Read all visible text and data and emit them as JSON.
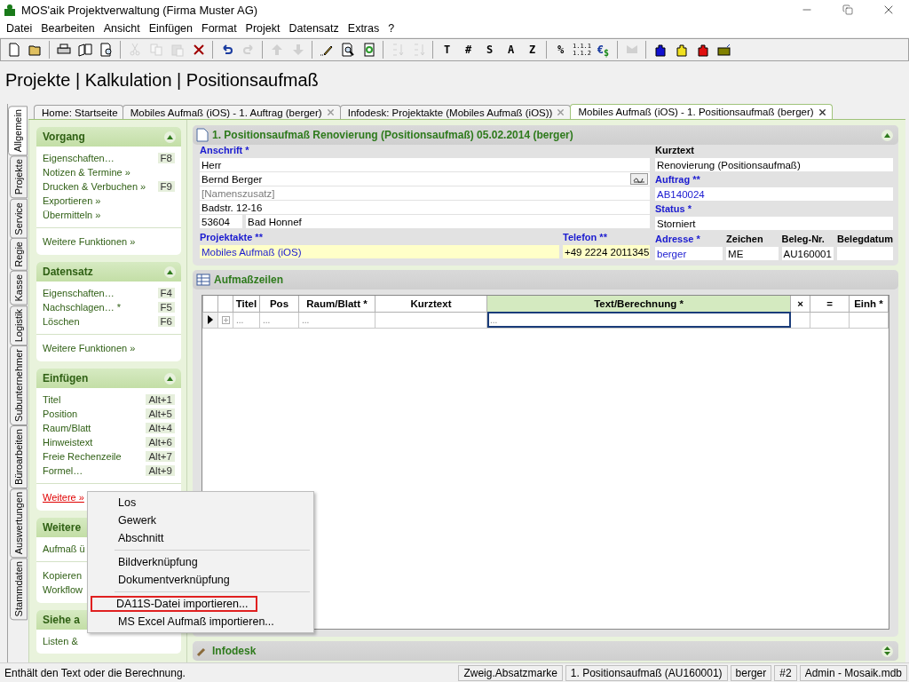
{
  "window": {
    "title": "MOS'aik Projektverwaltung (Firma Muster AG)"
  },
  "menu_bar": [
    "Datei",
    "Bearbeiten",
    "Ansicht",
    "Einfügen",
    "Format",
    "Projekt",
    "Datensatz",
    "Extras",
    "?"
  ],
  "toolbar": [
    {
      "kind": "icon",
      "disabled": false
    },
    {
      "kind": "icon",
      "disabled": false
    },
    {
      "kind": "separator"
    },
    {
      "kind": "icon",
      "disabled": false
    },
    {
      "kind": "icon",
      "disabled": false
    },
    {
      "kind": "icon",
      "disabled": false
    },
    {
      "kind": "separator"
    },
    {
      "kind": "icon",
      "disabled": true
    },
    {
      "kind": "icon",
      "disabled": true
    },
    {
      "kind": "icon",
      "disabled": true
    },
    {
      "kind": "icon",
      "disabled": false
    },
    {
      "kind": "separator"
    },
    {
      "kind": "icon",
      "disabled": false
    },
    {
      "kind": "icon",
      "disabled": true
    },
    {
      "kind": "separator"
    },
    {
      "kind": "icon",
      "disabled": true
    },
    {
      "kind": "icon",
      "disabled": true
    },
    {
      "kind": "separator"
    },
    {
      "kind": "icon",
      "disabled": false
    },
    {
      "kind": "icon",
      "disabled": false
    },
    {
      "kind": "icon",
      "disabled": false
    },
    {
      "kind": "separator"
    },
    {
      "kind": "icon",
      "disabled": true
    },
    {
      "kind": "icon",
      "disabled": true
    },
    {
      "kind": "separator"
    },
    {
      "kind": "text",
      "label": "T"
    },
    {
      "kind": "text",
      "label": "#"
    },
    {
      "kind": "text",
      "label": "S"
    },
    {
      "kind": "text",
      "label": "A"
    },
    {
      "kind": "text",
      "label": "Z"
    },
    {
      "kind": "separator"
    },
    {
      "kind": "text",
      "label": "%"
    },
    {
      "kind": "numbering",
      "lines": [
        "1.1.1",
        "1.1.2"
      ]
    },
    {
      "kind": "currency",
      "symbols": [
        "€",
        "$"
      ]
    },
    {
      "kind": "separator"
    },
    {
      "kind": "icon",
      "disabled": true
    },
    {
      "kind": "separator"
    },
    {
      "kind": "icon",
      "disabled": false
    },
    {
      "kind": "icon",
      "disabled": false
    },
    {
      "kind": "icon",
      "disabled": false
    },
    {
      "kind": "icon",
      "disabled": false
    }
  ],
  "heading": "Projekte | Kalkulation | Positionsaufmaß",
  "side_tabs": [
    {
      "label": "Allgemein",
      "selected": true
    },
    {
      "label": "Projekte",
      "selected": false
    },
    {
      "label": "Service",
      "selected": false
    },
    {
      "label": "Regie",
      "selected": false
    },
    {
      "label": "Kasse",
      "selected": false
    },
    {
      "label": "Logistik",
      "selected": false
    },
    {
      "label": "Subunternehmer",
      "selected": false
    },
    {
      "label": "Büroarbeiten",
      "selected": false
    },
    {
      "label": "Auswertungen",
      "selected": false
    },
    {
      "label": "Stammdaten",
      "selected": false
    }
  ],
  "doc_tabs": [
    {
      "label": "Home: Startseite",
      "selected": false,
      "closable": false
    },
    {
      "label": "Mobiles Aufmaß (iOS) - 1. Auftrag (berger)",
      "selected": false,
      "closable": true
    },
    {
      "label": "Infodesk: Projektakte (Mobiles Aufmaß (iOS))",
      "selected": false,
      "closable": true
    },
    {
      "label": "Mobiles Aufmaß (iOS) - 1. Positionsaufmaß (berger)",
      "selected": true,
      "closable": true
    }
  ],
  "sidebar": [
    {
      "title": "Vorgang",
      "collapsible": true,
      "items": [
        {
          "label": "Eigenschaften…",
          "shortcut": "F8"
        },
        {
          "label": "Notizen & Termine »"
        },
        {
          "label": "Drucken & Verbuchen »",
          "shortcut": "F9"
        },
        {
          "label": "Exportieren »"
        },
        {
          "label": "Übermitteln »"
        }
      ],
      "footer": [
        {
          "label": "Weitere Funktionen »",
          "hovered": false
        }
      ]
    },
    {
      "title": "Datensatz",
      "collapsible": true,
      "items": [
        {
          "label": "Eigenschaften…",
          "shortcut": "F4"
        },
        {
          "label": "Nachschlagen… *",
          "shortcut": "F5"
        },
        {
          "label": "Löschen",
          "shortcut": "F6"
        }
      ],
      "footer": [
        {
          "label": "Weitere Funktionen »",
          "hovered": false
        }
      ]
    },
    {
      "title": "Einfügen",
      "collapsible": true,
      "items": [
        {
          "label": "Titel",
          "shortcut": "Alt+1"
        },
        {
          "label": "Position",
          "shortcut": "Alt+5"
        },
        {
          "label": "Raum/Blatt",
          "shortcut": "Alt+4"
        },
        {
          "label": "Hinweistext",
          "shortcut": "Alt+6"
        },
        {
          "label": "Freie Rechenzeile",
          "shortcut": "Alt+7"
        },
        {
          "label": "Formel…",
          "shortcut": "Alt+9"
        }
      ],
      "footer": [
        {
          "label": "Weitere »",
          "hovered": true
        }
      ]
    },
    {
      "title": "Weitere",
      "items": [
        {
          "label": "Aufmaß ü"
        }
      ],
      "footer": [
        {
          "label": "Kopieren",
          "hovered": false
        },
        {
          "label": "Workflow",
          "hovered": false
        }
      ]
    },
    {
      "title": "Siehe a",
      "items": [
        {
          "label": "Listen &"
        }
      ]
    }
  ],
  "context_menu": [
    {
      "kind": "item",
      "label": "Los",
      "selected": false
    },
    {
      "kind": "item",
      "label": "Gewerk",
      "selected": false
    },
    {
      "kind": "item",
      "label": "Abschnitt",
      "selected": false
    },
    {
      "kind": "separator"
    },
    {
      "kind": "item",
      "label": "Bildverknüpfung",
      "selected": false
    },
    {
      "kind": "item",
      "label": "Dokumentverknüpfung",
      "selected": false
    },
    {
      "kind": "separator"
    },
    {
      "kind": "item",
      "label": "DA11S-Datei importieren...",
      "selected": true
    },
    {
      "kind": "item",
      "label": "MS Excel Aufmaß importieren...",
      "selected": false
    }
  ],
  "document": {
    "title": "1. Positionsaufmaß Renovierung (Positionsaufmaß) 05.02.2014 (berger)",
    "address": {
      "label": "Anschrift *",
      "required": true,
      "lines": [
        {
          "value": "Herr"
        },
        {
          "value": "Bernd Berger",
          "button": true
        },
        {
          "placeholder": "[Namenszusatz]"
        },
        {
          "value": "Badstr. 12-16"
        }
      ],
      "zip": "53604",
      "city": "Bad Honnef"
    },
    "project_file": {
      "label": "Projektakte **",
      "required": true,
      "value": "Mobiles Aufmaß (iOS)",
      "link": true
    },
    "phone": {
      "label": "Telefon **",
      "required": true,
      "value": "+49 2224 2011345",
      "link": false
    },
    "short_text": {
      "label": "Kurztext",
      "required": false,
      "value": "Renovierung (Positionsaufmaß)",
      "link": false
    },
    "order": {
      "label": "Auftrag **",
      "required": true,
      "value": "AB140024",
      "link": true
    },
    "status": {
      "label": "Status *",
      "required": true,
      "value": "Storniert",
      "link": false
    },
    "small_fields": [
      {
        "label": "Adresse *",
        "required": true,
        "value": "berger",
        "link": true
      },
      {
        "label": "Zeichen",
        "required": false,
        "value": "ME",
        "link": false
      },
      {
        "label": "Beleg-Nr.",
        "required": false,
        "value": "AU160001",
        "link": false
      },
      {
        "label": "Belegdatum",
        "required": false
      }
    ]
  },
  "lines_panel": {
    "title": "Aufmaßzeilen",
    "columns": [
      {
        "label": "Titel",
        "active": false
      },
      {
        "label": "Pos",
        "active": false
      },
      {
        "label": "Raum/Blatt *",
        "active": false
      },
      {
        "label": "Kurztext",
        "active": false
      },
      {
        "label": "Text/Berechnung *",
        "active": true
      },
      {
        "label": "×",
        "active": false
      },
      {
        "label": "=",
        "active": false
      },
      {
        "label": "Einh *",
        "active": false
      }
    ],
    "rows": [
      {
        "current": true,
        "cells": [
          "...",
          "...",
          "...",
          "",
          "...",
          "",
          "",
          ""
        ]
      }
    ]
  },
  "infodesk": {
    "title": "Infodesk",
    "expanded": false
  },
  "status_bar": [
    "Enthält den Text oder die Berechnung.",
    "Zweig.Absatzmarke",
    "1. Positionsaufmaß (AU160001)",
    "berger",
    "#2",
    "Admin - Mosaik.mdb"
  ]
}
